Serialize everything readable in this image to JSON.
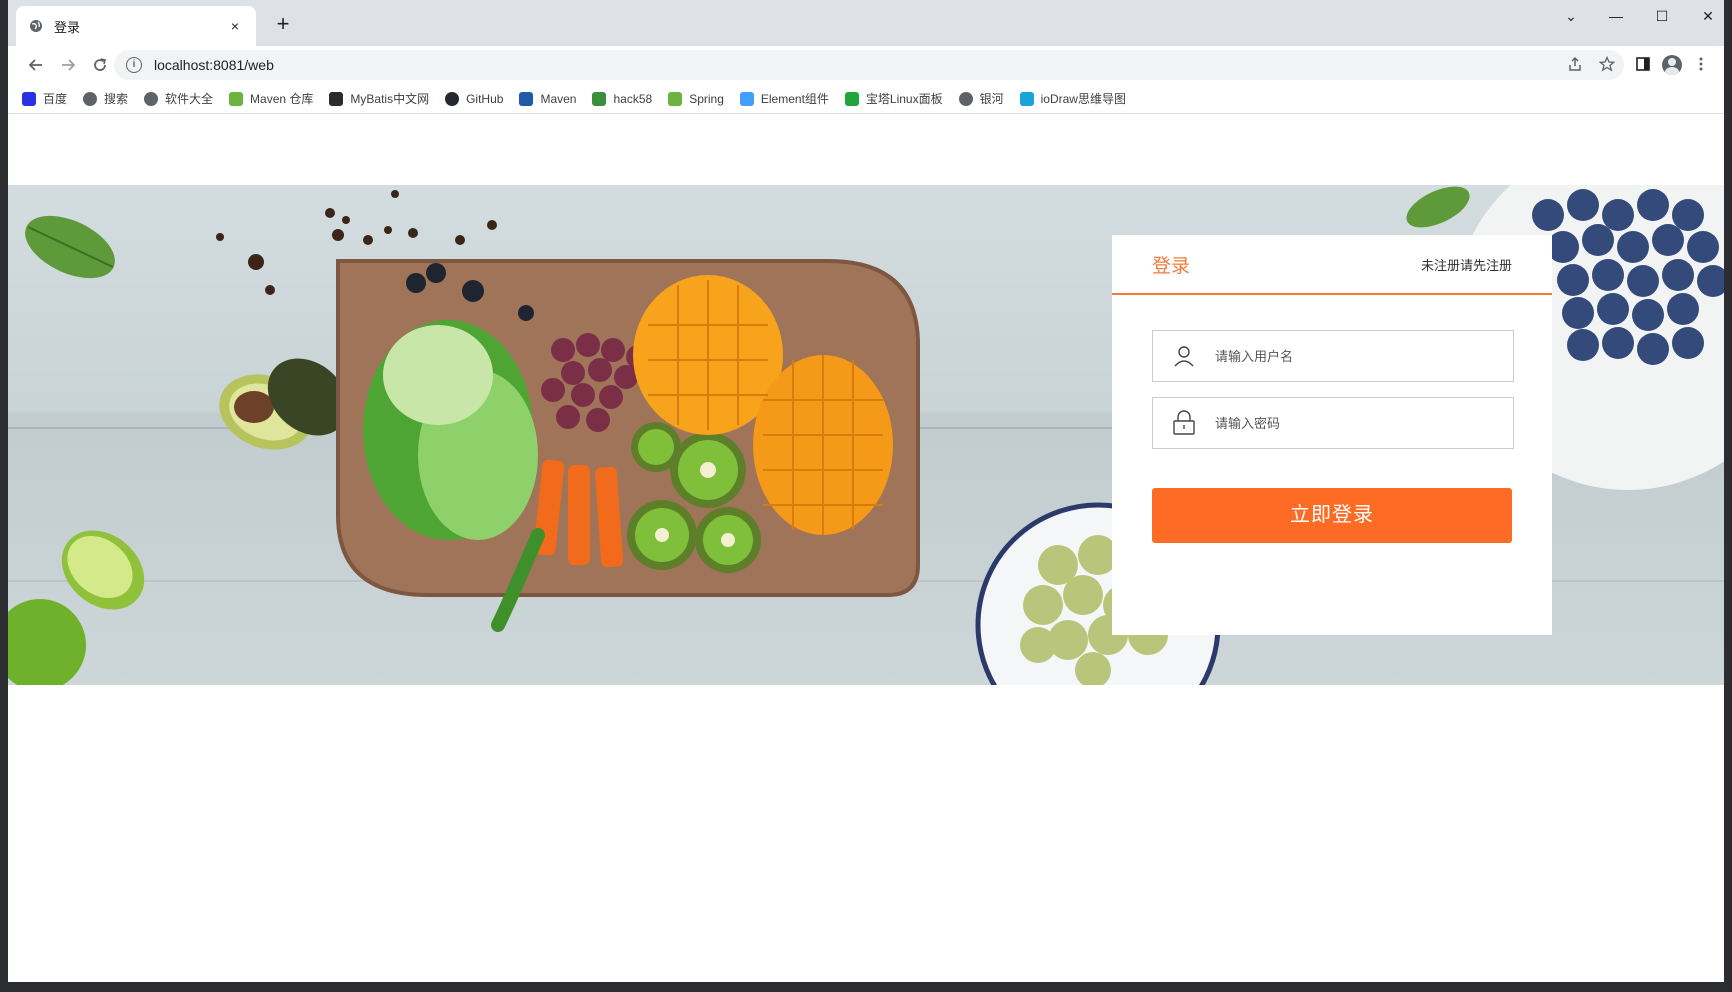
{
  "browser": {
    "tab": {
      "title": "登录",
      "close": "×"
    },
    "new_tab": "+",
    "window_controls": {
      "dropdown": "⌄",
      "minimize": "—",
      "maximize": "☐",
      "close": "✕"
    },
    "url": "localhost:8081/web",
    "bookmarks": [
      {
        "label": "百度",
        "icon": "baidu-icon",
        "color": "#2932e1"
      },
      {
        "label": "搜索",
        "icon": "globe-icon",
        "color": "#5f6368"
      },
      {
        "label": "软件大全",
        "icon": "globe-icon",
        "color": "#5f6368"
      },
      {
        "label": "Maven 仓库",
        "icon": "maven-repo-icon",
        "color": "#6db33f"
      },
      {
        "label": "MyBatis中文网",
        "icon": "mybatis-icon",
        "color": "#2b2b2b"
      },
      {
        "label": "GitHub",
        "icon": "github-icon",
        "color": "#24292f"
      },
      {
        "label": "Maven",
        "icon": "maven-icon",
        "color": "#1e5aa8"
      },
      {
        "label": "hack58",
        "icon": "hack58-icon",
        "color": "#3a8f3a"
      },
      {
        "label": "Spring",
        "icon": "spring-icon",
        "color": "#6db33f"
      },
      {
        "label": "Element组件",
        "icon": "element-icon",
        "color": "#409eff"
      },
      {
        "label": "宝塔Linux面板",
        "icon": "baota-icon",
        "color": "#20a53a"
      },
      {
        "label": "银河",
        "icon": "globe-icon",
        "color": "#5f6368"
      },
      {
        "label": "ioDraw思维导图",
        "icon": "iodraw-icon",
        "color": "#1aa3d9"
      }
    ]
  },
  "login": {
    "title": "登录",
    "register_link": "未注册请先注册",
    "username_placeholder": "请输入用户名",
    "password_placeholder": "请输入密码",
    "submit_label": "立即登录"
  },
  "colors": {
    "accent": "#f07b3a",
    "button": "#fd6b25"
  }
}
